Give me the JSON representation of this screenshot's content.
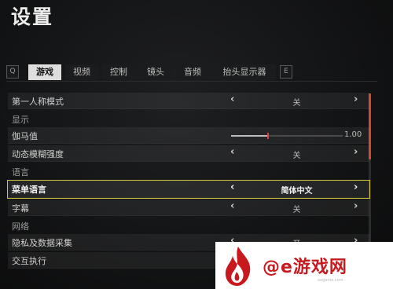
{
  "title": "设置",
  "tabbar": {
    "left_key": "Q",
    "right_key": "E",
    "tabs": [
      {
        "label": "游戏",
        "active": true
      },
      {
        "label": "视频",
        "active": false
      },
      {
        "label": "控制",
        "active": false
      },
      {
        "label": "镜头",
        "active": false
      },
      {
        "label": "音频",
        "active": false
      },
      {
        "label": "抬头显示器",
        "active": false
      }
    ]
  },
  "settings": {
    "first_person": {
      "label": "第一人称模式",
      "value": "关"
    },
    "section_display": "显示",
    "gamma": {
      "label": "伽马值",
      "value": "1.00",
      "fraction": 0.33
    },
    "motion_blur": {
      "label": "动态模糊强度",
      "value": "关"
    },
    "section_language": "语言",
    "menu_language": {
      "label": "菜单语言",
      "value": "简体中文"
    },
    "subtitles": {
      "label": "字幕",
      "value": "关"
    },
    "section_network": "网络",
    "privacy": {
      "label": "隐私及数据采集",
      "value": "开"
    },
    "crossplay": {
      "label": "交互执行",
      "value": ""
    }
  },
  "arrows": {
    "left": "‹",
    "right": "›"
  },
  "colors": {
    "accent_red": "#d2482c",
    "selection_outline": "#d9c83b",
    "watermark_red": "#c8191e"
  },
  "watermark": {
    "text": "@e游戏网",
    "sub": "aegame.com"
  }
}
